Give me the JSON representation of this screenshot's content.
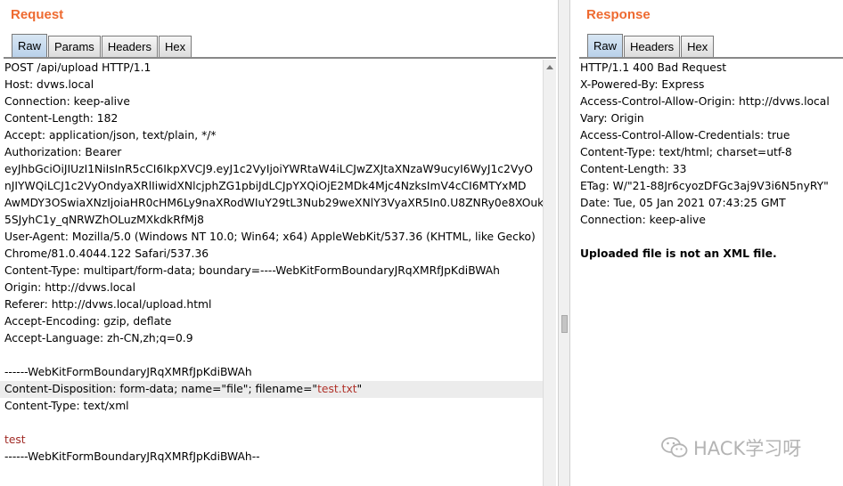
{
  "request": {
    "title": "Request",
    "tabs": [
      "Raw",
      "Params",
      "Headers",
      "Hex"
    ],
    "lines": [
      "POST /api/upload HTTP/1.1",
      "Host: dvws.local",
      "Connection: keep-alive",
      "Content-Length: 182",
      "Accept: application/json, text/plain, */*",
      "Authorization: Bearer",
      "eyJhbGciOiJIUzI1NiIsInR5cCI6IkpXVCJ9.eyJ1c2VyIjoiYWRtaW4iLCJwZXJtaXNzaW9ucyI6WyJ1c2VyO",
      "nJIYWQiLCJ1c2VyOndyaXRlIiwidXNlcjphZG1pbiJdLCJpYXQiOjE2MDk4Mjc4NzksImV4cCI6MTYxMD",
      "AwMDY3OSwiaXNzIjoiaHR0cHM6Ly9naXRodWIuY29tL3Nub29weXNlY3VyaXR5In0.U8ZNRy0e8XOukf",
      "5SJyhC1y_qNRWZhOLuzMXkdkRfMj8",
      "User-Agent: Mozilla/5.0 (Windows NT 10.0; Win64; x64) AppleWebKit/537.36 (KHTML, like Gecko)",
      "Chrome/81.0.4044.122 Safari/537.36",
      "Content-Type: multipart/form-data; boundary=----WebKitFormBoundaryJRqXMRfJpKdiBWAh",
      "Origin: http://dvws.local",
      "Referer: http://dvws.local/upload.html",
      "Accept-Encoding: gzip, deflate",
      "Accept-Language: zh-CN,zh;q=0.9",
      "",
      "------WebKitFormBoundaryJRqXMRfJpKdiBWAh",
      "Content-Disposition: form-data; name=\"file\"; filename=\"",
      "Content-Type: text/xml",
      "",
      "test",
      "------WebKitFormBoundaryJRqXMRfJpKdiBWAh--"
    ],
    "filename_value": "test.txt",
    "filename_suffix": "\""
  },
  "response": {
    "title": "Response",
    "tabs": [
      "Raw",
      "Headers",
      "Hex"
    ],
    "lines": [
      "HTTP/1.1 400 Bad Request",
      "X-Powered-By: Express",
      "Access-Control-Allow-Origin: http://dvws.local",
      "Vary: Origin",
      "Access-Control-Allow-Credentials: true",
      "Content-Type: text/html; charset=utf-8",
      "Content-Length: 33",
      "ETag: W/\"21-88Jr6cyozDFGc3aj9V3i6N5nyRY\"",
      "Date: Tue, 05 Jan 2021 07:43:25 GMT",
      "Connection: keep-alive",
      "",
      "Uploaded file is not an XML file."
    ]
  },
  "watermark": {
    "text": "HACK学习呀",
    "icon": "wechat-icon"
  },
  "colors": {
    "title": "#ee6a30",
    "active_tab": "#b9d1ea",
    "highlight": "#ececec",
    "value_red": "#b0322a"
  }
}
